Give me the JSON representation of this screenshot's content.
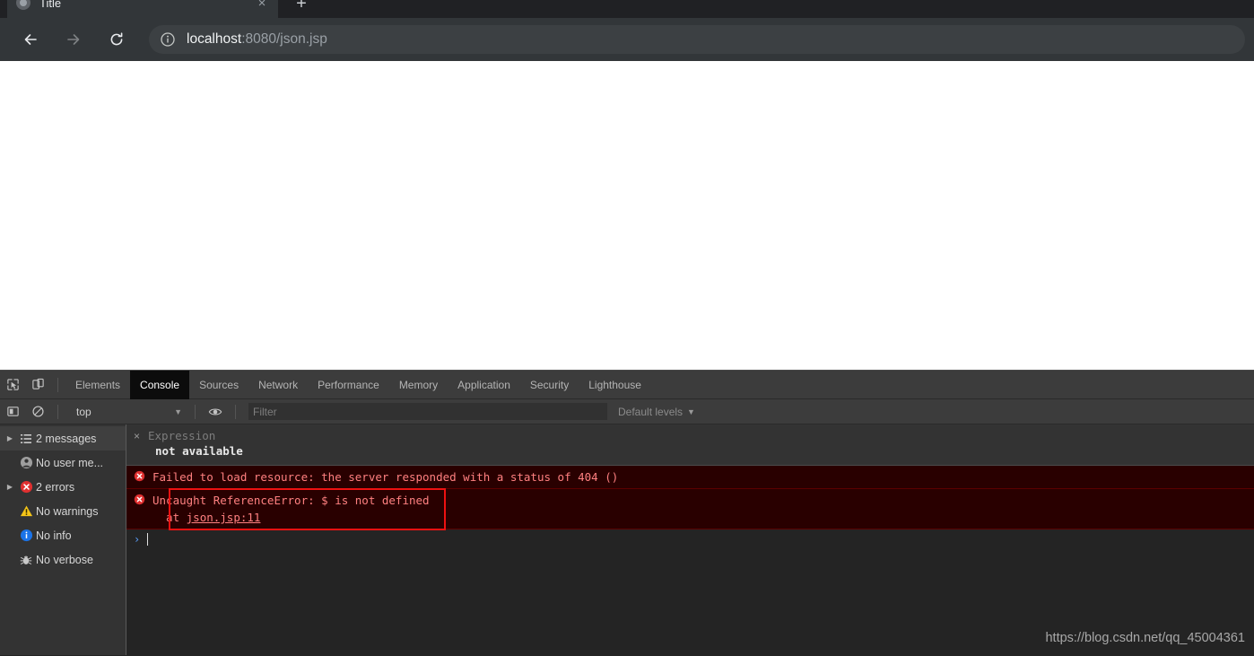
{
  "browser": {
    "tab": {
      "title": "Title",
      "close_label": "×",
      "favicon_name": "page-favicon"
    },
    "new_tab_label": "+",
    "nav": {
      "back_label": "Back",
      "forward_label": "Forward",
      "reload_label": "Reload"
    },
    "omnibox": {
      "info_icon": "info-circle-icon",
      "host": "localhost",
      "path": ":8080/json.jsp"
    }
  },
  "devtools": {
    "tools": {
      "inspect_icon": "inspect-element-icon",
      "device_icon": "device-toolbar-icon"
    },
    "tabs": [
      {
        "label": "Elements",
        "active": false
      },
      {
        "label": "Console",
        "active": true
      },
      {
        "label": "Sources",
        "active": false
      },
      {
        "label": "Network",
        "active": false
      },
      {
        "label": "Performance",
        "active": false
      },
      {
        "label": "Memory",
        "active": false
      },
      {
        "label": "Application",
        "active": false
      },
      {
        "label": "Security",
        "active": false
      },
      {
        "label": "Lighthouse",
        "active": false
      }
    ],
    "filterbar": {
      "sidebar_toggle_icon": "console-sidebar-toggle-icon",
      "clear_icon": "clear-console-icon",
      "context": "top",
      "context_caret": "▼",
      "eye_icon": "live-expression-eye-icon",
      "filter_placeholder": "Filter",
      "filter_value": "",
      "levels_label": "Default levels",
      "levels_caret": "▼"
    },
    "sidebar": [
      {
        "label": "2 messages",
        "icon": "list-icon",
        "arrow": "▶",
        "selected": true
      },
      {
        "label": "No user me...",
        "icon": "user-message-icon",
        "arrow": "",
        "selected": false
      },
      {
        "label": "2 errors",
        "icon": "error-icon",
        "arrow": "▶",
        "selected": false
      },
      {
        "label": "No warnings",
        "icon": "warning-icon",
        "arrow": "",
        "selected": false
      },
      {
        "label": "No info",
        "icon": "info-icon",
        "arrow": "",
        "selected": false
      },
      {
        "label": "No verbose",
        "icon": "verbose-bug-icon",
        "arrow": "",
        "selected": false
      }
    ],
    "console": {
      "live_expression": {
        "close_label": "×",
        "placeholder": "Expression",
        "value": "not available"
      },
      "messages": [
        {
          "icon": "error-icon",
          "text": "Failed to load resource: the server responded with a status of 404 ()"
        }
      ],
      "error_detail": {
        "icon": "error-icon",
        "message": "Uncaught ReferenceError: $ is not defined",
        "stack_prefix": "  at ",
        "stack_link": "json.jsp:11"
      },
      "prompt_chevron": "›"
    }
  },
  "watermark": "https://blog.csdn.net/qq_45004361",
  "colors": {
    "chrome_toolbar": "#323639",
    "devtools_bg": "#242424",
    "sidebar_bg": "#333333",
    "error_bg": "#290000",
    "error_text": "#ff8080",
    "annotation_red": "#ee1111",
    "prompt_blue": "#5a9cf8"
  }
}
